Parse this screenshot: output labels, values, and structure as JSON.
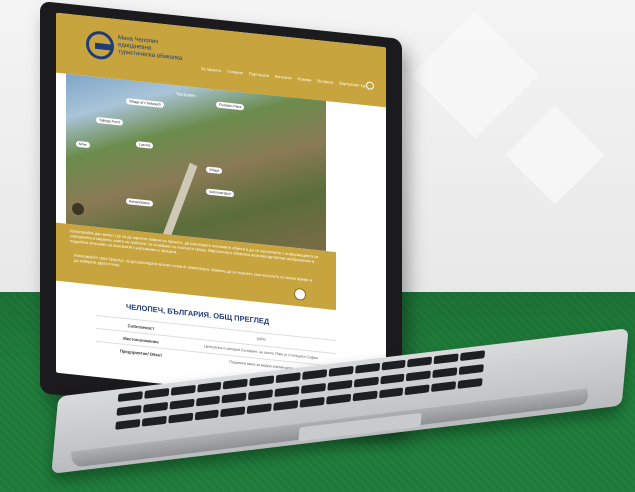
{
  "site": {
    "logo_text": "Мина Челопеч\nеднодневна туристическа\nобиколка",
    "nav": [
      "За проекта",
      "Галерия",
      "Партньори",
      "Контакти",
      "Новини",
      "Въпроси",
      "Виртуален тур"
    ],
    "hero_label": "Челопеч",
    "pins": [
      "Village of Chelopech",
      "Flotation Plant",
      "Tailings Pond",
      "Mine",
      "Lacuna",
      "Village",
      "Administration",
      "Rehabilitation"
    ],
    "gold_paragraph_1": "Използвайте дон мегал тур за да научите повече за проекта, да разгледате основните обекти и да се запознаете с информацията за компанията и мерките, които се прилагат за опазване на околната среда. Виртуалната обиколка включва детайлни изображения и подробни описания на основните съоръжения и процеси.",
    "gold_paragraph_2": "Използвайте своя браузър, за да разгледате всички точки от обиколката. Можете да се върнете към началото по всяко време и да изберете друга точка.",
    "page_title": "ЧЕЛОПЕЧ, БЪЛГАРИЯ. ОБЩ ПРЕГЛЕД",
    "table": [
      {
        "label": "Собственост",
        "value": "100%"
      },
      {
        "label": "Местоположение",
        "value": "Централна и западна България, на около 70км от столицата София"
      },
      {
        "label": "Предприятие/ Обект",
        "value": "Подземна мина за медно-златни руди"
      }
    ]
  }
}
